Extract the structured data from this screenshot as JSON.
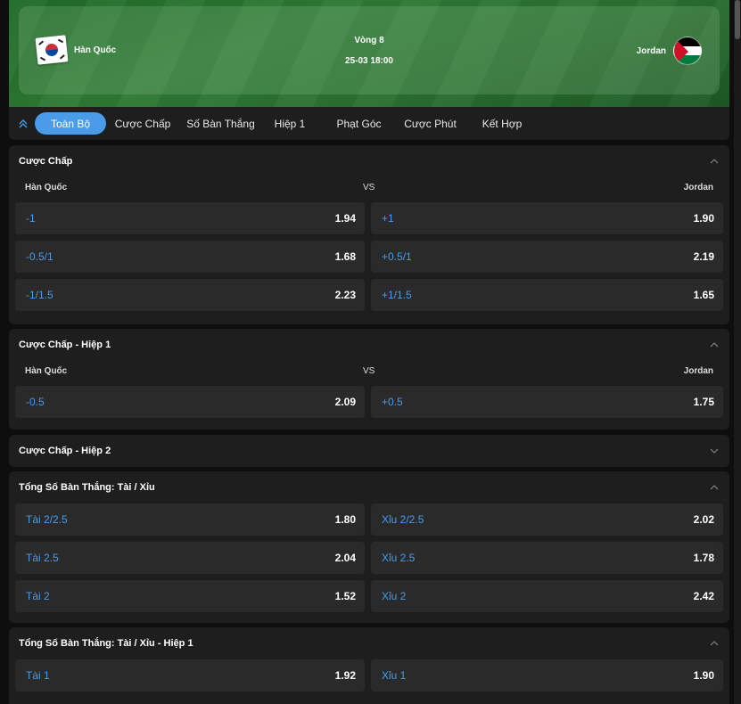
{
  "match": {
    "home_team": "Hàn Quốc",
    "away_team": "Jordan",
    "round": "Vòng 8",
    "datetime": "25-03 18:00"
  },
  "tabs": [
    "Toàn Bộ",
    "Cược Chấp",
    "Số Bàn Thắng",
    "Hiệp 1",
    "Phạt Góc",
    "Cược Phút",
    "Kết Hợp"
  ],
  "active_tab": "Toàn Bộ",
  "colors": {
    "accent": "#4a9be8",
    "panel": "#1e1e1e",
    "cell": "#2a2a2a",
    "banner": "#2e7a35"
  },
  "markets": [
    {
      "title": "Cược Chấp",
      "expanded": true,
      "header": {
        "home": "Hàn Quốc",
        "vs": "VS",
        "away": "Jordan"
      },
      "rows": [
        [
          {
            "label": "-1",
            "odd": "1.94"
          },
          {
            "label": "+1",
            "odd": "1.90"
          }
        ],
        [
          {
            "label": "-0.5/1",
            "odd": "1.68"
          },
          {
            "label": "+0.5/1",
            "odd": "2.19"
          }
        ],
        [
          {
            "label": "-1/1.5",
            "odd": "2.23"
          },
          {
            "label": "+1/1.5",
            "odd": "1.65"
          }
        ]
      ]
    },
    {
      "title": "Cược Chấp - Hiệp 1",
      "expanded": true,
      "header": {
        "home": "Hàn Quốc",
        "vs": "VS",
        "away": "Jordan"
      },
      "rows": [
        [
          {
            "label": "-0.5",
            "odd": "2.09"
          },
          {
            "label": "+0.5",
            "odd": "1.75"
          }
        ]
      ]
    },
    {
      "title": "Cược Chấp - Hiệp 2",
      "expanded": false
    },
    {
      "title": "Tổng Số Bàn Thắng: Tài / Xỉu",
      "expanded": true,
      "rows": [
        [
          {
            "label": "Tài 2/2.5",
            "odd": "1.80"
          },
          {
            "label": "Xỉu 2/2.5",
            "odd": "2.02"
          }
        ],
        [
          {
            "label": "Tài 2.5",
            "odd": "2.04"
          },
          {
            "label": "Xỉu 2.5",
            "odd": "1.78"
          }
        ],
        [
          {
            "label": "Tài 2",
            "odd": "1.52"
          },
          {
            "label": "Xỉu 2",
            "odd": "2.42"
          }
        ]
      ]
    },
    {
      "title": "Tổng Số Bàn Thắng: Tài / Xỉu - Hiệp 1",
      "expanded": true,
      "rows": [
        [
          {
            "label": "Tài 1",
            "odd": "1.92"
          },
          {
            "label": "Xỉu 1",
            "odd": "1.90"
          }
        ]
      ]
    }
  ]
}
